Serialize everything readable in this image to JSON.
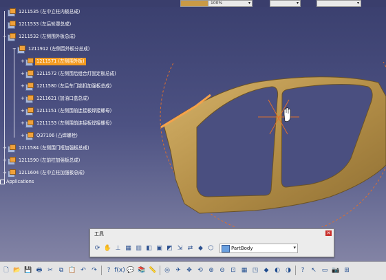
{
  "top_fields": [
    {
      "value": "",
      "kind": "color-swatch"
    },
    {
      "value": "100%"
    },
    {
      "value": ""
    },
    {
      "value": ""
    }
  ],
  "tree": [
    {
      "id": "1211535",
      "text": "1211535 (左中立柱内板总成)",
      "level": 0,
      "expand": ""
    },
    {
      "id": "1211533",
      "text": "1211533 (左后轮罩总成)",
      "level": 0,
      "expand": ""
    },
    {
      "id": "1211532",
      "text": "1211532 (左侧围外板总成)",
      "level": 0,
      "expand": "-"
    },
    {
      "id": "1211912",
      "text": "1211912 (左侧围外板分总成)",
      "level": 1,
      "expand": "-"
    },
    {
      "id": "1211571",
      "text": "1211571 (左侧围外板)",
      "level": 2,
      "expand": "+",
      "selected": true
    },
    {
      "id": "1211572",
      "text": "1211572 (左侧围后组合灯固定板总成)",
      "level": 2,
      "expand": "+"
    },
    {
      "id": "1211580",
      "text": "1211580 (左后车门锁扣加强板总成)",
      "level": 2,
      "expand": "+"
    },
    {
      "id": "1211621",
      "text": "1211621 (加油口盒总成)",
      "level": 2,
      "expand": "+"
    },
    {
      "id": "1211151",
      "text": "1211151 (左侧围前连接板焊接螺母)",
      "level": 2,
      "expand": "+"
    },
    {
      "id": "1211153",
      "text": "1211153 (左侧围前连接板焊接螺母)",
      "level": 2,
      "expand": "+"
    },
    {
      "id": "Q37106",
      "text": "Q37106 (凸焊螺栓)",
      "level": 2,
      "expand": "+"
    },
    {
      "id": "1211584",
      "text": "1211584 (左侧围门框加强板总成)",
      "level": 0,
      "expand": "+"
    },
    {
      "id": "1211590",
      "text": "1211590 (左前柱加强板总成)",
      "level": 0,
      "expand": "+"
    },
    {
      "id": "1211604",
      "text": "1211604 (左中立柱加强板总成)",
      "level": 0,
      "expand": "+"
    }
  ],
  "applications_label": "Applications",
  "tool_panel": {
    "title": "工具",
    "close_icon": "close-icon",
    "icons": [
      "update-icon",
      "hand-icon",
      "axis-icon",
      "grid-icon",
      "snap-icon",
      "block-icon",
      "part-icon",
      "analysis-icon",
      "measure-icon",
      "swap-icon",
      "param-icon",
      "formula-icon"
    ],
    "partbody_label": "PartBody"
  },
  "bottom_toolbar": {
    "icons": [
      "new-icon",
      "open-icon",
      "save-icon",
      "print-icon",
      "cut-icon",
      "copy-icon",
      "paste-icon",
      "undo-icon",
      "redo-icon",
      "whats-this-icon",
      "formula-icon",
      "knowledge-icon",
      "catalog-icon",
      "measure-icon",
      "compass-icon",
      "fly-icon",
      "pan-icon",
      "rotate-icon",
      "zoom-in-icon",
      "zoom-out-icon",
      "normal-view-icon",
      "multi-view-icon",
      "iso-view-icon",
      "shading-icon",
      "hide-show-icon",
      "swap-visible-icon",
      "help-icon",
      "cursor-icon",
      "window-icon",
      "camera-icon",
      "extra-icon"
    ]
  },
  "colors": {
    "background_top": "#3a3f6e",
    "background_bottom": "#8a8aa9",
    "selection": "#f39a1f",
    "model_body": "#b6934e",
    "compass_circle": "#e0702c"
  }
}
